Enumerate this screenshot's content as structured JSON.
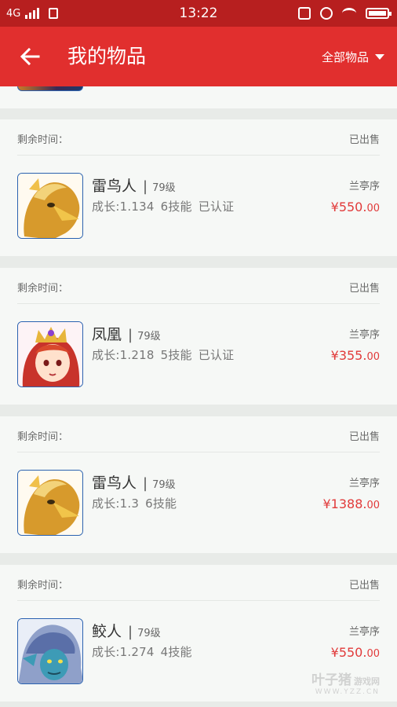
{
  "status_bar": {
    "network": "4G",
    "time": "13:22"
  },
  "app_bar": {
    "title": "我的物品",
    "filter_label": "全部物品"
  },
  "colors": {
    "status_bar": "#b71f1f",
    "app_bar": "#e12f2e",
    "price": "#e13a3a",
    "card_bg": "#f6f8f6",
    "divider_bg": "#e8ebe8"
  },
  "orders": [
    {
      "time_label": "剩余时间：",
      "status": "已出售",
      "pet_name": "雷鸟人",
      "level": "79级",
      "growth": "成长:1.134",
      "skills": "6技能",
      "certified": "已认证",
      "seller": "兰亭序",
      "price_main": "¥550.",
      "price_cents": "00",
      "avatar_icon": "thunderbird-pet-icon"
    },
    {
      "time_label": "剩余时间：",
      "status": "已出售",
      "pet_name": "凤凰",
      "level": "79级",
      "growth": "成长:1.218",
      "skills": "5技能",
      "certified": "已认证",
      "seller": "兰亭序",
      "price_main": "¥355.",
      "price_cents": "00",
      "avatar_icon": "phoenix-pet-icon"
    },
    {
      "time_label": "剩余时间：",
      "status": "已出售",
      "pet_name": "雷鸟人",
      "level": "79级",
      "growth": "成长:1.3",
      "skills": "6技能",
      "certified": "",
      "seller": "兰亭序",
      "price_main": "¥1388.",
      "price_cents": "00",
      "avatar_icon": "thunderbird-pet-icon"
    },
    {
      "time_label": "剩余时间：",
      "status": "已出售",
      "pet_name": "鲛人",
      "level": "79级",
      "growth": "成长:1.274",
      "skills": "4技能",
      "certified": "",
      "seller": "兰亭序",
      "price_main": "¥550.",
      "price_cents": "00",
      "avatar_icon": "merman-pet-icon"
    }
  ],
  "watermark": {
    "brand": "叶子猪",
    "sub": "游戏网",
    "url": "WWW.YZZ.CN"
  }
}
